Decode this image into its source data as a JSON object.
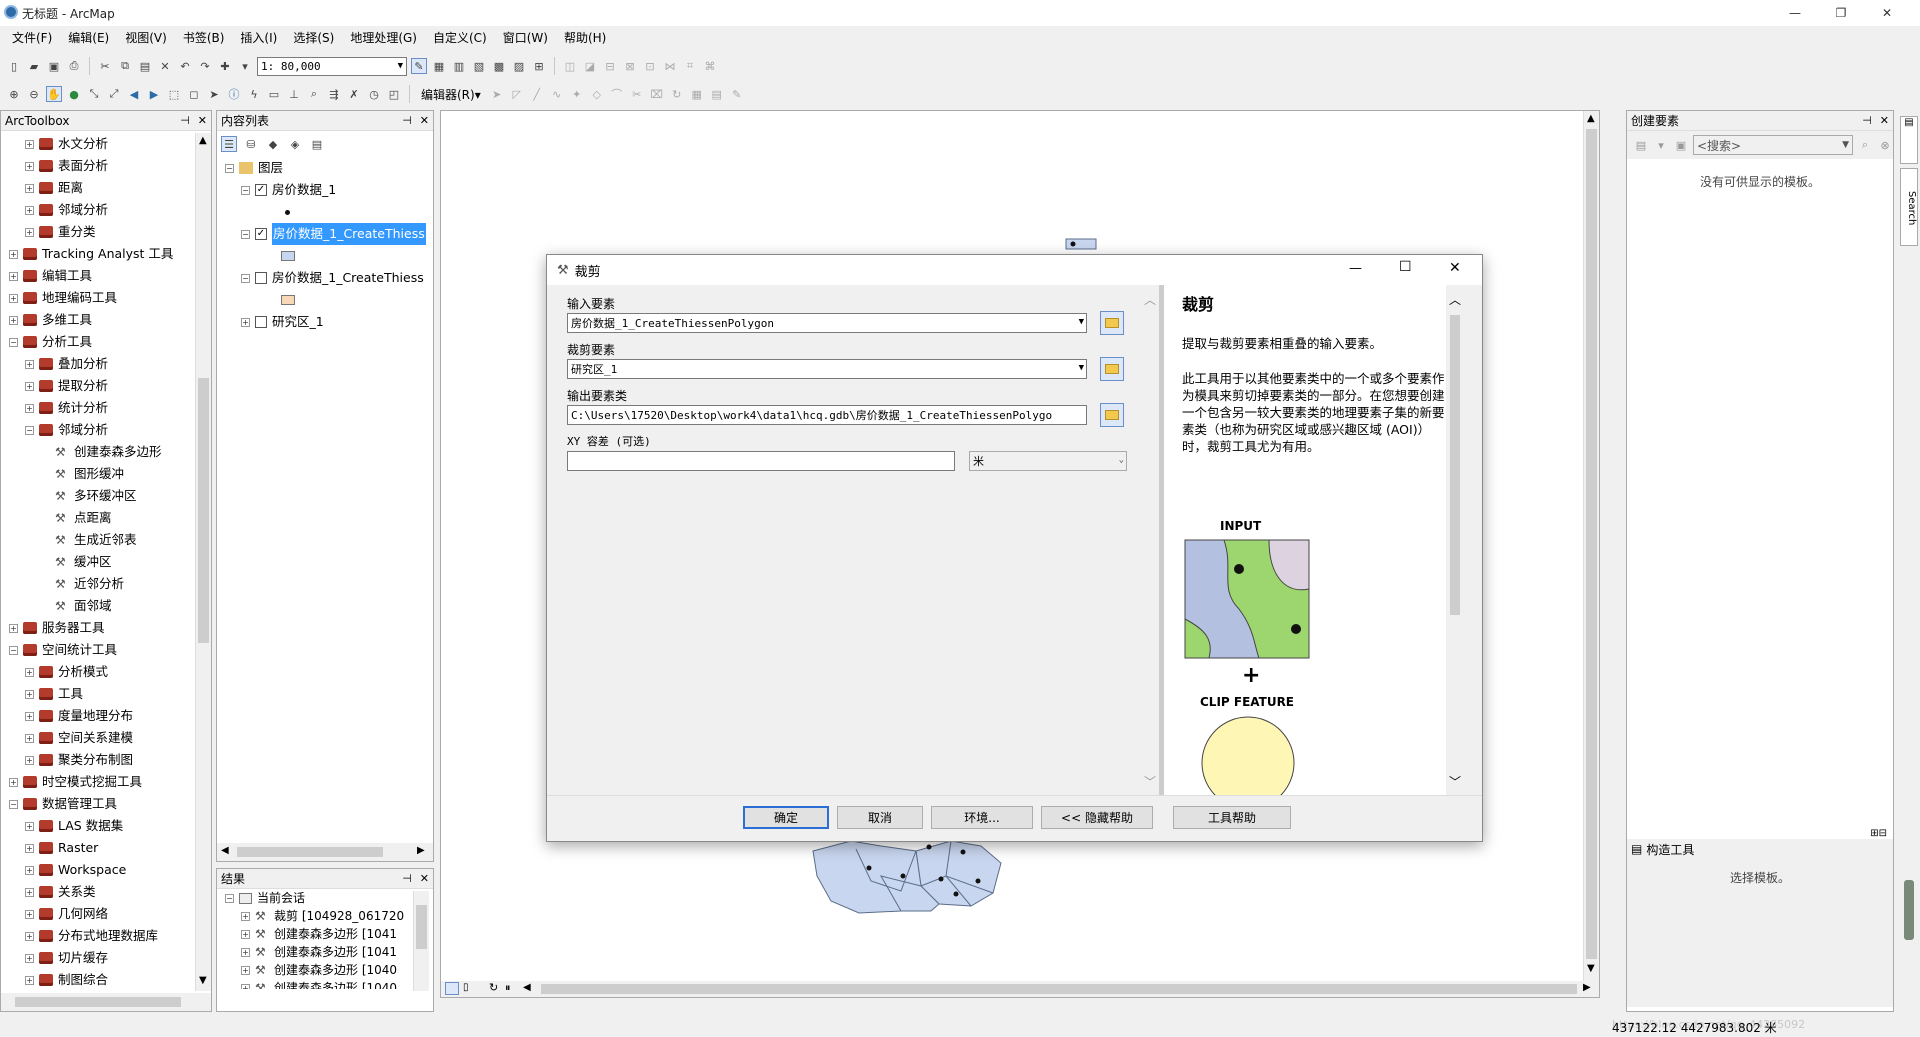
{
  "window": {
    "title": "无标题 - ArcMap",
    "min": "—",
    "max": "❐",
    "close": "✕"
  },
  "menu": [
    "文件(F)",
    "编辑(E)",
    "视图(V)",
    "书签(B)",
    "插入(I)",
    "选择(S)",
    "地理处理(G)",
    "自定义(C)",
    "窗口(W)",
    "帮助(H)"
  ],
  "toolbar": {
    "scale": "1: 80,000",
    "editor_label": "编辑器(R)▾"
  },
  "arctoolbox": {
    "title": "ArcToolbox",
    "items": [
      {
        "label": "水文分析",
        "level": 1,
        "kind": "toolset",
        "exp": "+"
      },
      {
        "label": "表面分析",
        "level": 1,
        "kind": "toolset",
        "exp": "+"
      },
      {
        "label": "距离",
        "level": 1,
        "kind": "toolset",
        "exp": "+"
      },
      {
        "label": "邻域分析",
        "level": 1,
        "kind": "toolset",
        "exp": "+"
      },
      {
        "label": "重分类",
        "level": 1,
        "kind": "toolset",
        "exp": "+"
      },
      {
        "label": "Tracking Analyst 工具",
        "level": 0,
        "kind": "toolbox",
        "exp": "+"
      },
      {
        "label": "编辑工具",
        "level": 0,
        "kind": "toolbox",
        "exp": "+"
      },
      {
        "label": "地理编码工具",
        "level": 0,
        "kind": "toolbox",
        "exp": "+"
      },
      {
        "label": "多维工具",
        "level": 0,
        "kind": "toolbox",
        "exp": "+"
      },
      {
        "label": "分析工具",
        "level": 0,
        "kind": "toolbox",
        "exp": "−"
      },
      {
        "label": "叠加分析",
        "level": 1,
        "kind": "toolset",
        "exp": "+"
      },
      {
        "label": "提取分析",
        "level": 1,
        "kind": "toolset",
        "exp": "+"
      },
      {
        "label": "统计分析",
        "level": 1,
        "kind": "toolset",
        "exp": "+"
      },
      {
        "label": "邻域分析",
        "level": 1,
        "kind": "toolset",
        "exp": "−"
      },
      {
        "label": "创建泰森多边形",
        "level": 2,
        "kind": "tool",
        "exp": ""
      },
      {
        "label": "图形缓冲",
        "level": 2,
        "kind": "tool",
        "exp": ""
      },
      {
        "label": "多环缓冲区",
        "level": 2,
        "kind": "tool",
        "exp": ""
      },
      {
        "label": "点距离",
        "level": 2,
        "kind": "tool",
        "exp": ""
      },
      {
        "label": "生成近邻表",
        "level": 2,
        "kind": "tool",
        "exp": ""
      },
      {
        "label": "缓冲区",
        "level": 2,
        "kind": "tool",
        "exp": ""
      },
      {
        "label": "近邻分析",
        "level": 2,
        "kind": "tool",
        "exp": ""
      },
      {
        "label": "面邻域",
        "level": 2,
        "kind": "tool",
        "exp": ""
      },
      {
        "label": "服务器工具",
        "level": 0,
        "kind": "toolbox",
        "exp": "+"
      },
      {
        "label": "空间统计工具",
        "level": 0,
        "kind": "toolbox",
        "exp": "−"
      },
      {
        "label": "分析模式",
        "level": 1,
        "kind": "toolset",
        "exp": "+"
      },
      {
        "label": "工具",
        "level": 1,
        "kind": "toolset",
        "exp": "+"
      },
      {
        "label": "度量地理分布",
        "level": 1,
        "kind": "toolset",
        "exp": "+"
      },
      {
        "label": "空间关系建模",
        "level": 1,
        "kind": "toolset",
        "exp": "+"
      },
      {
        "label": "聚类分布制图",
        "level": 1,
        "kind": "toolset",
        "exp": "+"
      },
      {
        "label": "时空模式挖掘工具",
        "level": 0,
        "kind": "toolbox",
        "exp": "+"
      },
      {
        "label": "数据管理工具",
        "level": 0,
        "kind": "toolbox",
        "exp": "−"
      },
      {
        "label": "LAS 数据集",
        "level": 1,
        "kind": "toolset",
        "exp": "+"
      },
      {
        "label": "Raster",
        "level": 1,
        "kind": "toolset",
        "exp": "+"
      },
      {
        "label": "Workspace",
        "level": 1,
        "kind": "toolset",
        "exp": "+"
      },
      {
        "label": "关系类",
        "level": 1,
        "kind": "toolset",
        "exp": "+"
      },
      {
        "label": "几何网络",
        "level": 1,
        "kind": "toolset",
        "exp": "+"
      },
      {
        "label": "分布式地理数据库",
        "level": 1,
        "kind": "toolset",
        "exp": "+"
      },
      {
        "label": "切片缓存",
        "level": 1,
        "kind": "toolset",
        "exp": "+"
      },
      {
        "label": "制图综合",
        "level": 1,
        "kind": "toolset",
        "exp": "+"
      }
    ]
  },
  "toc": {
    "title": "内容列表",
    "root": "图层",
    "layers": [
      {
        "name": "房价数据_1",
        "checked": "✓",
        "selected": false,
        "swatch": "point",
        "exp": "−"
      },
      {
        "name": "房价数据_1_CreateThiess",
        "checked": "✓",
        "selected": true,
        "swatch": "#c9d6ef",
        "exp": "−"
      },
      {
        "name": "房价数据_1_CreateThiess",
        "checked": "",
        "selected": false,
        "swatch": "#f7d9b8",
        "exp": "−"
      },
      {
        "name": "研究区_1",
        "checked": "",
        "selected": false,
        "swatch": "",
        "exp": "+"
      }
    ]
  },
  "results": {
    "title": "结果",
    "root": "当前会话",
    "items": [
      "裁剪 [104928_061720",
      "创建泰森多边形 [1041",
      "创建泰森多边形 [1041",
      "创建泰森多边形 [1040",
      "创建泰森多边形 [1040"
    ]
  },
  "dialog": {
    "title": "裁剪",
    "input_label": "输入要素",
    "input_value": "房价数据_1_CreateThiessenPolygon",
    "clip_label": "裁剪要素",
    "clip_value": "研究区_1",
    "output_label": "输出要素类",
    "output_value": "C:\\Users\\17520\\Desktop\\work4\\data1\\hcq.gdb\\房价数据_1_CreateThiessenPolygo",
    "xy_label": "XY 容差 (可选)",
    "xy_value": "",
    "unit_value": "米",
    "buttons": {
      "ok": "确定",
      "cancel": "取消",
      "env": "环境...",
      "hide": "<< 隐藏帮助",
      "toolhelp": "工具帮助"
    },
    "help": {
      "heading": "裁剪",
      "para1": "提取与裁剪要素相重叠的输入要素。",
      "para2": "此工具用于以其他要素类中的一个或多个要素作为模具来剪切掉要素类的一部分。在您想要创建一个包含另一较大要素类的地理要素子集的新要素类（也称为研究区域或感兴趣区域 (AOI)）时，裁剪工具尤为有用。",
      "input_caption": "INPUT",
      "plus": "+",
      "clip_caption": "CLIP FEATURE"
    }
  },
  "create_features": {
    "title": "创建要素",
    "search_placeholder": "<搜索>",
    "empty_text": "没有可供显示的模板。",
    "construct_title": "构造工具",
    "construct_text": "选择模板。",
    "side_tab": "Search"
  },
  "status": {
    "coords": "437122.12  4427983.802 米",
    "watermark": "https://blog.csdn.net/qq_44285092"
  },
  "colors": {
    "selected": "#3399ff",
    "titlebar_close": "#e81123",
    "default_btn": "#2b6fd6"
  }
}
